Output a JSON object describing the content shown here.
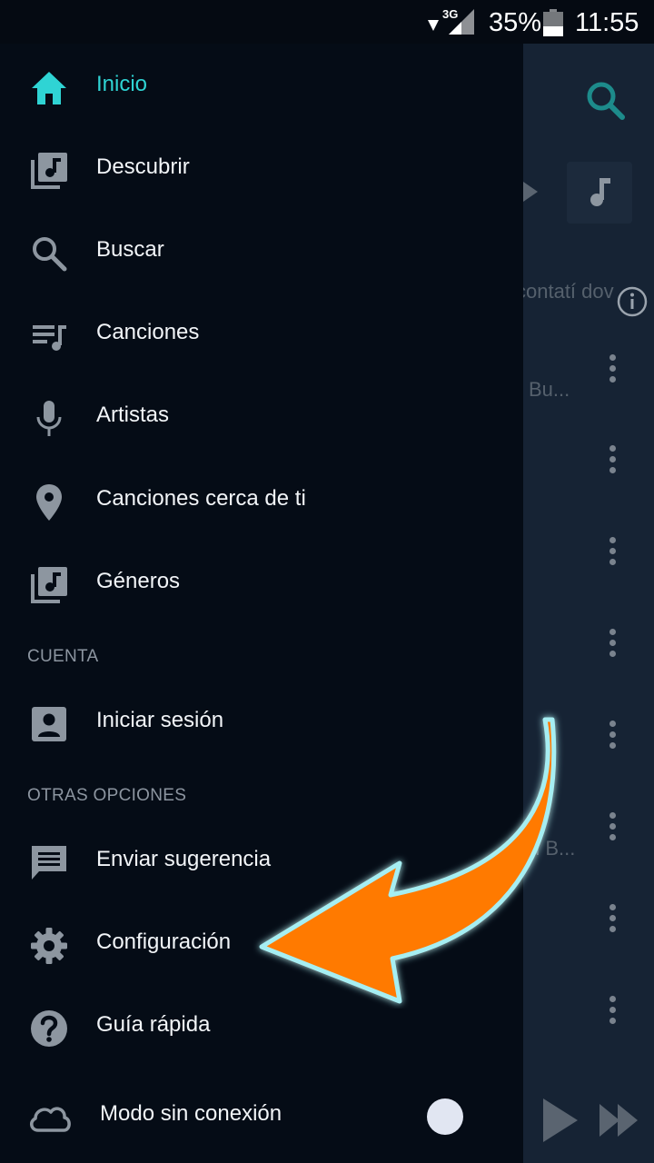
{
  "status_bar": {
    "network": "3G",
    "battery": "35%",
    "time": "11:55"
  },
  "drawer": {
    "items": [
      {
        "label": "Inicio",
        "icon": "home-icon",
        "active": true
      },
      {
        "label": "Descubrir",
        "icon": "library-music-icon"
      },
      {
        "label": "Buscar",
        "icon": "search-icon"
      },
      {
        "label": "Canciones",
        "icon": "queue-music-icon"
      },
      {
        "label": "Artistas",
        "icon": "mic-icon"
      },
      {
        "label": "Canciones cerca de ti",
        "icon": "location-pin-icon"
      },
      {
        "label": "Géneros",
        "icon": "library-music-icon"
      }
    ],
    "sections": {
      "account": "CUENTA",
      "other": "OTRAS OPCIONES"
    },
    "account_items": [
      {
        "label": "Iniciar sesión",
        "icon": "account-box-icon"
      }
    ],
    "other_items": [
      {
        "label": "Enviar sugerencia",
        "icon": "feedback-icon"
      },
      {
        "label": "Configuración",
        "icon": "gear-icon"
      },
      {
        "label": "Guía rápida",
        "icon": "help-icon"
      }
    ],
    "offline": {
      "label": "Modo sin conexión",
      "icon": "cloud-icon",
      "enabled": false
    }
  },
  "background": {
    "snippet_1": "contatí dov",
    "snippet_2": "Bu...",
    "snippet_3": "d B..."
  },
  "colors": {
    "accent": "#2fd4d4",
    "drawer_bg": "#050c16",
    "arrow": "#ff7a00"
  }
}
